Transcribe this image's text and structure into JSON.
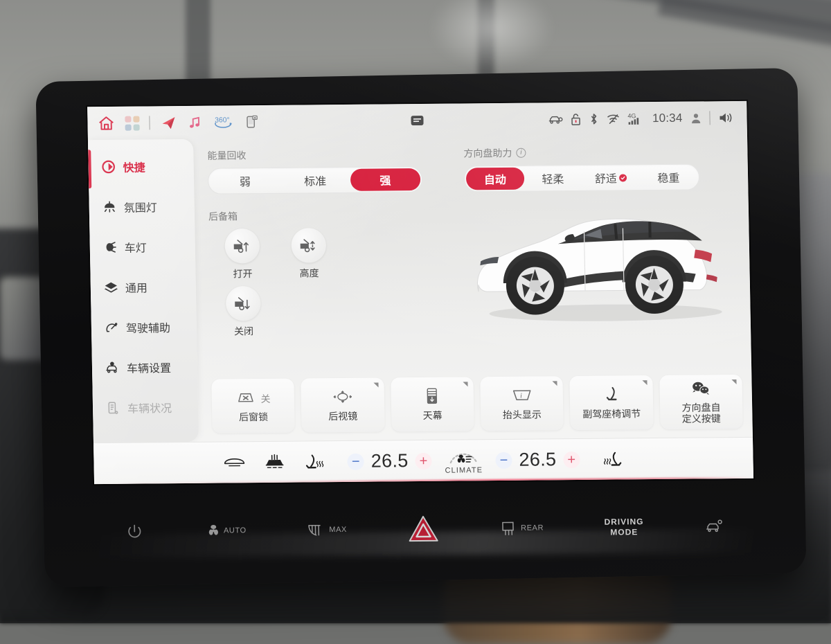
{
  "status_bar": {
    "app_icons": [
      {
        "name": "home-icon",
        "glyph": "home"
      },
      {
        "name": "apps-grid-icon",
        "glyph": "grid"
      },
      {
        "name": "navigation-icon",
        "glyph": "nav-arrow"
      },
      {
        "name": "music-icon",
        "glyph": "music-note"
      },
      {
        "name": "surround-view-360-icon",
        "label": "360°"
      },
      {
        "name": "phone-cast-icon",
        "glyph": "phone"
      }
    ],
    "center_indicator": "card-indicator",
    "right_icons": [
      {
        "name": "car-lock-status-icon"
      },
      {
        "name": "door-lock-icon"
      },
      {
        "name": "bluetooth-icon"
      },
      {
        "name": "wifi-off-icon"
      },
      {
        "name": "cellular-signal-icon",
        "label": "4G"
      }
    ],
    "time": "10:34",
    "profile_icon": "user-avatar-icon",
    "volume_icon": "speaker-icon"
  },
  "sidebar": {
    "items": [
      {
        "label": "快捷",
        "icon": "quick-access-icon",
        "state": "active"
      },
      {
        "label": "氛围灯",
        "icon": "ambient-light-icon",
        "state": "normal"
      },
      {
        "label": "车灯",
        "icon": "headlight-icon",
        "state": "normal"
      },
      {
        "label": "通用",
        "icon": "layers-icon",
        "state": "normal"
      },
      {
        "label": "驾驶辅助",
        "icon": "driving-assist-icon",
        "state": "normal"
      },
      {
        "label": "车辆设置",
        "icon": "vehicle-settings-icon",
        "state": "normal"
      },
      {
        "label": "车辆状况",
        "icon": "vehicle-status-icon",
        "state": "disabled"
      }
    ]
  },
  "main": {
    "energy_recovery": {
      "label": "能量回收",
      "options": [
        "弱",
        "标准",
        "强"
      ],
      "selected": "强"
    },
    "steering_assist": {
      "label": "方向盘助力",
      "info_icon": "info-icon",
      "options": [
        {
          "label": "自动",
          "badge": false
        },
        {
          "label": "轻柔",
          "badge": false
        },
        {
          "label": "舒适",
          "badge": true
        },
        {
          "label": "稳重",
          "badge": false
        }
      ],
      "selected": "自动"
    },
    "trunk": {
      "label": "后备箱",
      "buttons": [
        {
          "label": "打开",
          "icon": "trunk-open-icon"
        },
        {
          "label": "高度",
          "icon": "trunk-height-icon"
        },
        {
          "label": "关闭",
          "icon": "trunk-close-icon"
        }
      ]
    },
    "car_illustration": "vehicle-side-view-white",
    "shortcut_cards": [
      {
        "label": "后窗锁",
        "icon": "rear-window-lock-icon",
        "state_text": "关",
        "corner": false
      },
      {
        "label": "后视镜",
        "icon": "side-mirror-icon",
        "state_text": "",
        "corner": true
      },
      {
        "label": "天幕",
        "icon": "panoramic-roof-icon",
        "state_text": "",
        "corner": true
      },
      {
        "label": "抬头显示",
        "icon": "head-up-display-icon",
        "state_text": "",
        "corner": true
      },
      {
        "label": "副驾座椅调节",
        "icon": "passenger-seat-icon",
        "state_text": "",
        "corner": true
      },
      {
        "label": "方向盘自\n定义按键",
        "icon": "steering-wheel-custom-key-icon",
        "state_text": "",
        "corner": true
      }
    ]
  },
  "climate_bar": {
    "left_icons": [
      {
        "name": "windshield-defrost-icon"
      },
      {
        "name": "rear-defrost-icon"
      },
      {
        "name": "driver-seat-heat-icon"
      }
    ],
    "driver_temp": {
      "minus": "−",
      "value": "26.5",
      "plus": "+"
    },
    "passenger_temp": {
      "minus": "−",
      "value": "26.5",
      "plus": "+"
    },
    "climate_button": {
      "label": "CLIMATE",
      "icon": "fan-dial-icon"
    },
    "right_icon": {
      "name": "passenger-seat-heat-icon"
    }
  },
  "hardware_buttons": [
    {
      "name": "power-button",
      "label": ""
    },
    {
      "name": "auto-fan-button",
      "label": "AUTO"
    },
    {
      "name": "max-defrost-button",
      "label": "MAX"
    },
    {
      "name": "hazard-lights-button",
      "label": ""
    },
    {
      "name": "rear-defrost-button",
      "label": "REAR"
    },
    {
      "name": "driving-mode-button",
      "label_line1": "DRIVING",
      "label_line2": "MODE"
    },
    {
      "name": "parking-assist-button",
      "label": ""
    }
  ],
  "colors": {
    "accent_red": "#d4102f",
    "screen_bg": "#eeeeed",
    "text_primary": "#2e2e2e",
    "text_muted": "#757575"
  }
}
